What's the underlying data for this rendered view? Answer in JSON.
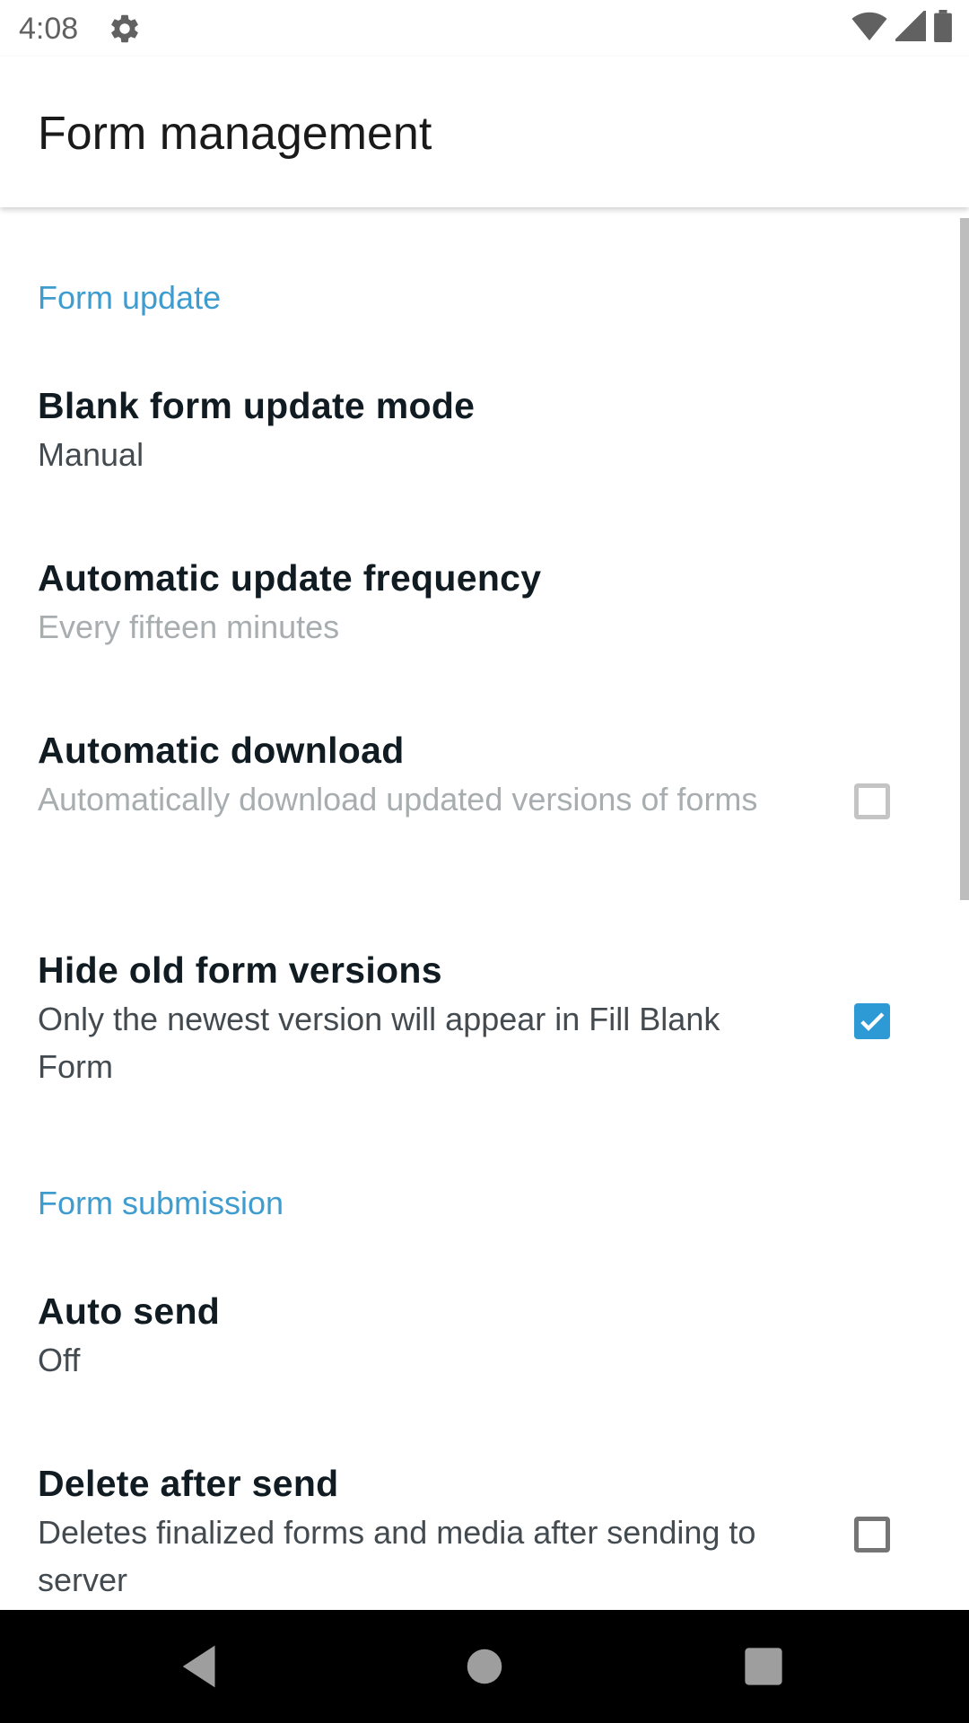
{
  "status_bar": {
    "time": "4:08",
    "icons": [
      "gear-icon",
      "wifi-icon",
      "cellular-signal-icon",
      "battery-icon"
    ]
  },
  "app_bar": {
    "title": "Form management"
  },
  "colors": {
    "accent": "#3f9ccf",
    "checkbox_checked": "#2d9ad6",
    "title_text": "#111b22",
    "summary_text": "#444b50",
    "disabled_text": "#a8adb0",
    "nav_bar": "#000000"
  },
  "sections": [
    {
      "header": "Form update",
      "items": [
        {
          "title": "Blank form update mode",
          "summary": "Manual",
          "enabled": true
        },
        {
          "title": "Automatic update frequency",
          "summary": "Every fifteen minutes",
          "enabled": false
        },
        {
          "title": "Automatic download",
          "summary": "Automatically download updated versions of forms",
          "enabled": false,
          "checkbox": true,
          "checked": false
        },
        {
          "title": "Hide old form versions",
          "summary": "Only the newest version will appear in Fill Blank Form",
          "enabled": true,
          "checkbox": true,
          "checked": true
        }
      ]
    },
    {
      "header": "Form submission",
      "items": [
        {
          "title": "Auto send",
          "summary": "Off",
          "enabled": true
        },
        {
          "title": "Delete after send",
          "summary": "Deletes finalized forms and media after sending to server",
          "enabled": true,
          "checkbox": true,
          "checked": false
        }
      ]
    }
  ],
  "nav_bar": {
    "buttons": [
      "back-icon",
      "home-icon",
      "recents-icon"
    ]
  }
}
